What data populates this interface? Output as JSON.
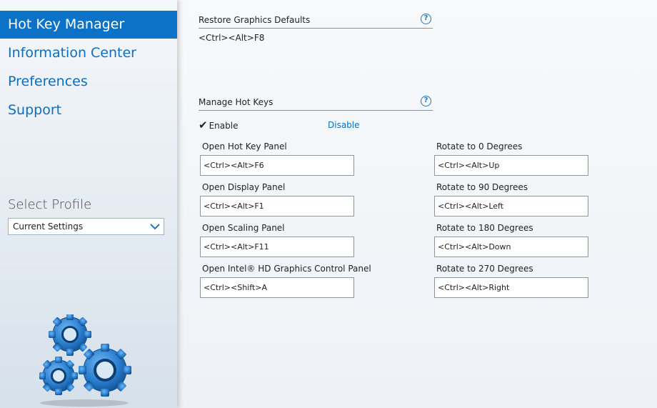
{
  "sidebar": {
    "nav": [
      {
        "label": "Hot Key Manager",
        "active": true
      },
      {
        "label": "Information Center",
        "active": false
      },
      {
        "label": "Preferences",
        "active": false
      },
      {
        "label": "Support",
        "active": false
      }
    ],
    "profile_title": "Select Profile",
    "profile_value": "Current Settings"
  },
  "restore": {
    "title": "Restore Graphics Defaults",
    "help": "?",
    "value": "<Ctrl><Alt>F8"
  },
  "manage": {
    "title": "Manage Hot Keys",
    "help": "?",
    "enable_label": "Enable",
    "enable_mark": "✔",
    "disable_label": "Disable"
  },
  "hotkeys_left": [
    {
      "label": "Open Hot Key Panel",
      "value": "<Ctrl><Alt>F6"
    },
    {
      "label": "Open Display Panel",
      "value": "<Ctrl><Alt>F1"
    },
    {
      "label": "Open Scaling Panel",
      "value": "<Ctrl><Alt>F11"
    },
    {
      "label": "Open Intel® HD Graphics Control Panel",
      "value": "<Ctrl><Shift>A"
    }
  ],
  "hotkeys_right": [
    {
      "label": "Rotate to 0 Degrees",
      "value": "<Ctrl><Alt>Up"
    },
    {
      "label": "Rotate to 90 Degrees",
      "value": "<Ctrl><Alt>Left"
    },
    {
      "label": "Rotate to 180 Degrees",
      "value": "<Ctrl><Alt>Down"
    },
    {
      "label": "Rotate to 270 Degrees",
      "value": "<Ctrl><Alt>Right"
    }
  ],
  "colors": {
    "accent": "#0c72c8",
    "link": "#0a6fc2"
  }
}
